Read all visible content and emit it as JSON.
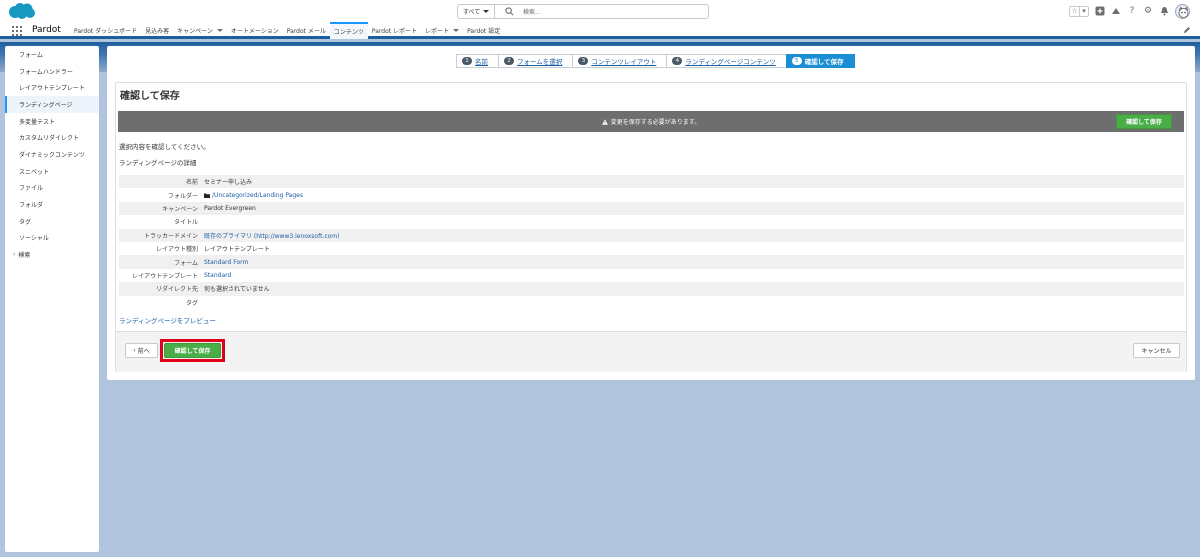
{
  "header": {
    "search_scope": "すべて",
    "search_placeholder": "検索..."
  },
  "nav": {
    "app_name": "Pardot",
    "tabs": [
      {
        "label": "Pardot ダッシュボード"
      },
      {
        "label": "見込み客"
      },
      {
        "label": "キャンペーン"
      },
      {
        "label": "オートメーション"
      },
      {
        "label": "Pardot メール"
      },
      {
        "label": "コンテンツ"
      },
      {
        "label": "Pardot レポート"
      },
      {
        "label": "レポート"
      },
      {
        "label": "Pardot 設定"
      }
    ]
  },
  "sidebar": {
    "items": [
      {
        "label": "フォーム"
      },
      {
        "label": "フォームハンドラー"
      },
      {
        "label": "レイアウトテンプレート"
      },
      {
        "label": "ランディングページ"
      },
      {
        "label": "多変量テスト"
      },
      {
        "label": "カスタムリダイレクト"
      },
      {
        "label": "ダイナミックコンテンツ"
      },
      {
        "label": "スニペット"
      },
      {
        "label": "ファイル"
      },
      {
        "label": "フォルダ"
      },
      {
        "label": "タグ"
      },
      {
        "label": "ソーシャル"
      },
      {
        "label": "検索"
      }
    ]
  },
  "wizard": {
    "steps": [
      {
        "num": "1",
        "label": "名前"
      },
      {
        "num": "2",
        "label": "フォームを選択"
      },
      {
        "num": "3",
        "label": "コンテンツレイアウト"
      },
      {
        "num": "4",
        "label": "ランディングページコンテンツ"
      },
      {
        "num": "5",
        "label": "確認して保存"
      }
    ]
  },
  "main": {
    "title": "確認して保存",
    "warning": "変更を保存する必要があります。",
    "warning_button": "確認して保存",
    "intro": "選択内容を確認してください。",
    "details_heading": "ランディングページの詳細",
    "details": [
      {
        "label": "名前",
        "value": "セミナー申し込み"
      },
      {
        "label": "フォルダー",
        "value": "/Uncategorized/Landing Pages"
      },
      {
        "label": "キャンペーン",
        "value": "Pardot Evergreen"
      },
      {
        "label": "タイトル",
        "value": ""
      },
      {
        "label": "トラッカードメイン",
        "value": "既存のプライマリ (http://www3.lenoxsoft.com)"
      },
      {
        "label": "レイアウト種別",
        "value": "レイアウトテンプレート"
      },
      {
        "label": "フォーム",
        "value": "Standard Form"
      },
      {
        "label": "レイアウトテンプレート",
        "value": "Standard"
      },
      {
        "label": "リダイレクト先",
        "value": "何も選択されていません"
      },
      {
        "label": "タグ",
        "value": ""
      }
    ],
    "preview_link": "ランディングページをプレビュー",
    "back_button": "前へ",
    "save_button": "確認して保存",
    "cancel_button": "キャンセル"
  },
  "colors": {
    "accent": "#1b96ff",
    "header_band": "#1f5f9e",
    "save_green": "#4aae48",
    "highlight_red": "#e0001b"
  }
}
